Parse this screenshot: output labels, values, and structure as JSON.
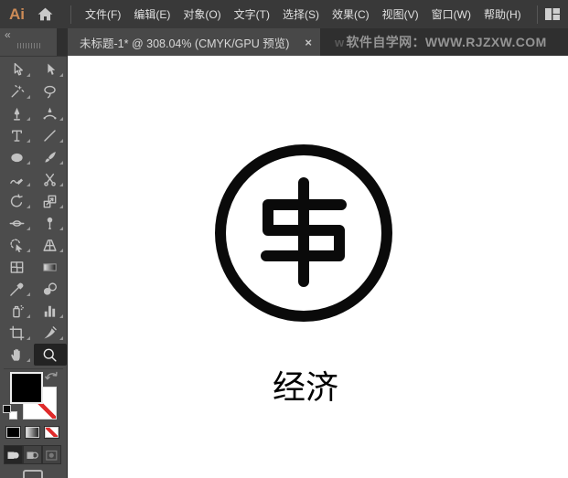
{
  "menubar": {
    "logo": "Ai",
    "items": [
      "文件(F)",
      "编辑(E)",
      "对象(O)",
      "文字(T)",
      "选择(S)",
      "效果(C)",
      "视图(V)",
      "窗口(W)",
      "帮助(H)"
    ]
  },
  "tabbar": {
    "collapse_glyph": "«",
    "tab_title": "未标题-1* @ 308.04% (CMYK/GPU 预览)",
    "close_glyph": "×",
    "watermark_faint": "w",
    "watermark": "软件自学网：WWW.RJZXW.COM"
  },
  "toolbar": {
    "tools": [
      {
        "name": "selection-tool",
        "fly": true
      },
      {
        "name": "direct-selection-tool",
        "fly": true
      },
      {
        "name": "magic-wand-tool",
        "fly": true
      },
      {
        "name": "lasso-tool",
        "fly": false
      },
      {
        "name": "pen-tool",
        "fly": true
      },
      {
        "name": "curvature-tool",
        "fly": true
      },
      {
        "name": "type-tool",
        "fly": true
      },
      {
        "name": "line-segment-tool",
        "fly": true
      },
      {
        "name": "ellipse-tool",
        "fly": true
      },
      {
        "name": "paintbrush-tool",
        "fly": true
      },
      {
        "name": "shaper-tool",
        "fly": true
      },
      {
        "name": "scissors-tool",
        "fly": true
      },
      {
        "name": "rotate-tool",
        "fly": true
      },
      {
        "name": "scale-tool",
        "fly": true
      },
      {
        "name": "width-tool",
        "fly": true
      },
      {
        "name": "puppet-warp-tool",
        "fly": true
      },
      {
        "name": "shape-builder-tool",
        "fly": true
      },
      {
        "name": "perspective-grid-tool",
        "fly": true
      },
      {
        "name": "mesh-tool",
        "fly": false
      },
      {
        "name": "gradient-tool",
        "fly": false
      },
      {
        "name": "eyedropper-tool",
        "fly": true
      },
      {
        "name": "blend-tool",
        "fly": false
      },
      {
        "name": "symbol-sprayer-tool",
        "fly": true
      },
      {
        "name": "column-graph-tool",
        "fly": true
      },
      {
        "name": "artboard-tool",
        "fly": true
      },
      {
        "name": "slice-tool",
        "fly": true
      },
      {
        "name": "hand-tool",
        "fly": true
      },
      {
        "name": "zoom-tool",
        "fly": false,
        "selected": true
      }
    ]
  },
  "color_controls": {
    "fill": "#000000",
    "stroke": "none",
    "paint_buttons": [
      "color",
      "gradient",
      "none"
    ],
    "draw_modes": [
      "draw-normal",
      "draw-behind",
      "draw-inside"
    ],
    "active_draw_mode": "draw-normal"
  },
  "canvas": {
    "caption": "经济"
  },
  "colors": {
    "menubar_bg": "#393939",
    "tabbar_bg": "#2f2f2f",
    "tab_bg": "#484848",
    "toolbar_bg": "#4c4c4c",
    "selected_tool_bg": "#232323",
    "icon_gray": "#c2c2c2",
    "logo": "#cd8b57",
    "canvas": "#ffffff",
    "artwork": "#0a0a0a",
    "none_red": "#df2b2b",
    "watermark": "#949494"
  }
}
